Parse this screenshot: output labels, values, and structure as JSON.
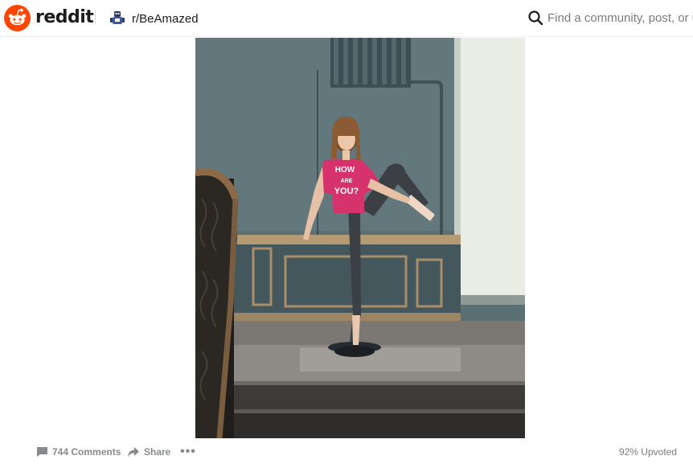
{
  "header": {
    "brand": "reddit",
    "subreddit": "r/BeAmazed",
    "search_placeholder": "Find a community, post, or us"
  },
  "icons": {
    "logo": "reddit-snoo-logo",
    "subreddit": "subreddit-avatar-icon",
    "search": "search-icon",
    "comments": "comment-icon",
    "share": "share-arrow-icon",
    "more": "ellipsis-icon"
  },
  "post": {
    "media_caption": "",
    "comments_label": "744 Comments",
    "share_label": "Share",
    "more_label": "•••",
    "upvoted_label": "92% Upvoted",
    "shirt_text_1": "HOW",
    "shirt_text_2": "ARE",
    "shirt_text_3": "YOU?"
  },
  "colors": {
    "brand_orange": "#ff4500",
    "wall": "#5b7075",
    "window": "#e9ede3",
    "shirt": "#d6336c",
    "muted": "#878a8c"
  }
}
